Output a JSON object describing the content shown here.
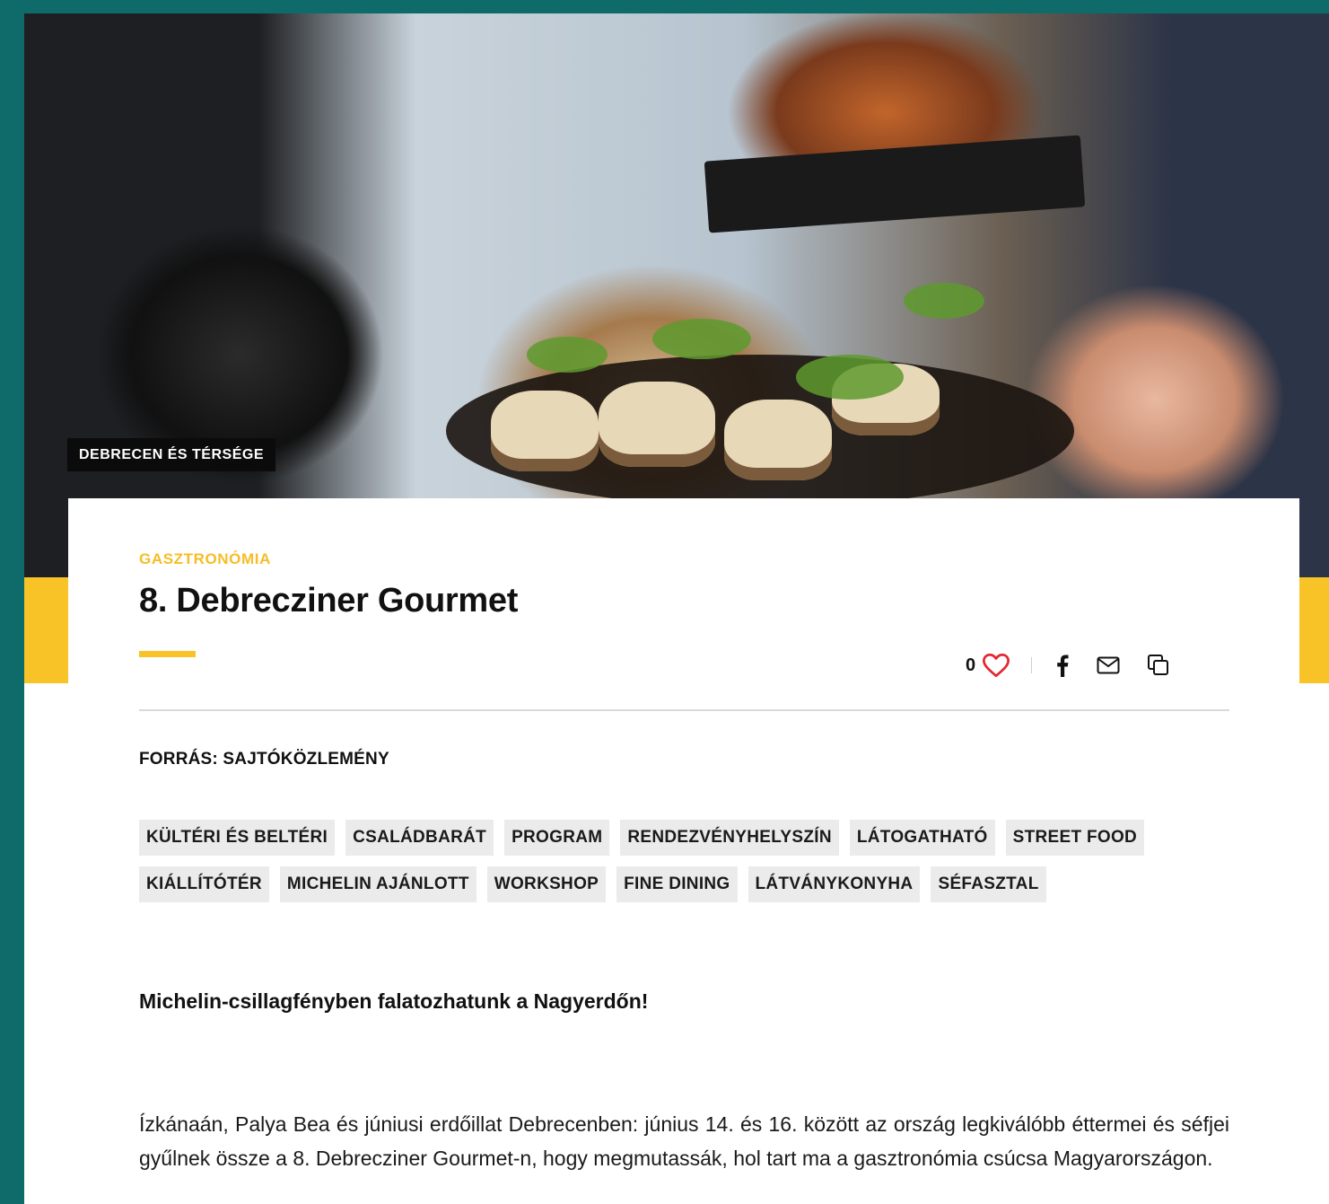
{
  "hero": {
    "region_badge": "DEBRECEN ÉS TÉRSÉGE"
  },
  "article": {
    "category": "GASZTRONÓMIA",
    "title": "8. Debrecziner Gourmet",
    "likes": "0",
    "source": "FORRÁS: SAJTÓKÖZLEMÉNY",
    "tags": [
      "KÜLTÉRI ÉS BELTÉRI",
      "CSALÁDBARÁT",
      "PROGRAM",
      "RENDEZVÉNYHELYSZÍN",
      "LÁTOGATHATÓ",
      "STREET FOOD",
      "KIÁLLÍTÓTÉR",
      "MICHELIN AJÁNLOTT",
      "WORKSHOP",
      "FINE DINING",
      "LÁTVÁNYKONYHA",
      "SÉFASZTAL"
    ],
    "lead": "Michelin-csillagfényben falatozhatunk a Nagyerdőn!",
    "body": "Ízkánaán, Palya Bea és júniusi erdőillat Debrecenben: június 14. és 16. között az ország legkiválóbb éttermei és séfjei gyűlnek össze a 8. Debrecziner Gourmet-n, hogy megmutassák, hol tart ma a gasztronómia csúcsa Magyarországon."
  },
  "icons": {
    "like": "heart-icon",
    "facebook": "facebook-icon",
    "email": "mail-icon",
    "copy": "copy-icon"
  },
  "colors": {
    "frame": "#0e6b6a",
    "accent": "#f8c326",
    "heart": "#e3262f"
  }
}
